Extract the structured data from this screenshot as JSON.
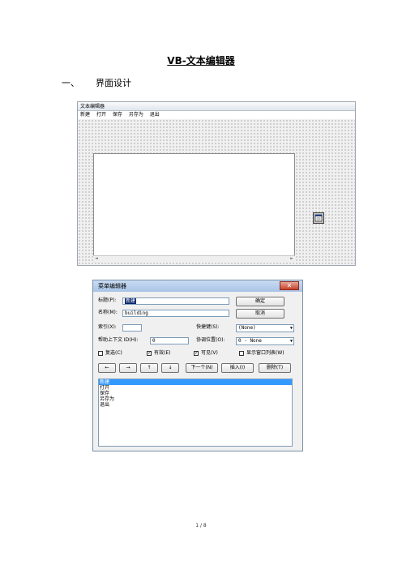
{
  "document": {
    "title": "VB-文本编辑器",
    "section_number": "一、",
    "section_title": "界面设计",
    "page_number": "1 / 8"
  },
  "form_designer": {
    "window_title": "文本编辑器",
    "menu": [
      "新建",
      "打开",
      "保存",
      "另存为",
      "退出"
    ],
    "scroll_left": "◄",
    "scroll_right": "►"
  },
  "menu_editor": {
    "window_title": "菜单编辑器",
    "close_glyph": "✕",
    "caption_label": "标题(P):",
    "caption_value": "新建",
    "name_label": "名称(M):",
    "name_value": "building",
    "index_label": "索引(X):",
    "index_value": "",
    "shortcut_label": "快捷键(S):",
    "shortcut_value": "(None)",
    "helpid_label": "帮助上下文 ID(H):",
    "helpid_value": "0",
    "negotiate_label": "协调位置(O):",
    "negotiate_value": "0 - None",
    "checked_label": "复选(C)",
    "enabled_label": "有效(E)",
    "visible_label": "可见(V)",
    "windowlist_label": "显示窗口列表(W)",
    "check_mark": "✓",
    "ok_label": "确定",
    "cancel_label": "取消",
    "arrow_left": "←",
    "arrow_right": "→",
    "arrow_up": "↑",
    "arrow_down": "↓",
    "next_label": "下一个(N)",
    "insert_label": "插入(I)",
    "delete_label": "删除(T)",
    "combo_arrow": "▼",
    "list_items": [
      "新建",
      "打开",
      "保存",
      "另存为",
      "退出"
    ]
  }
}
